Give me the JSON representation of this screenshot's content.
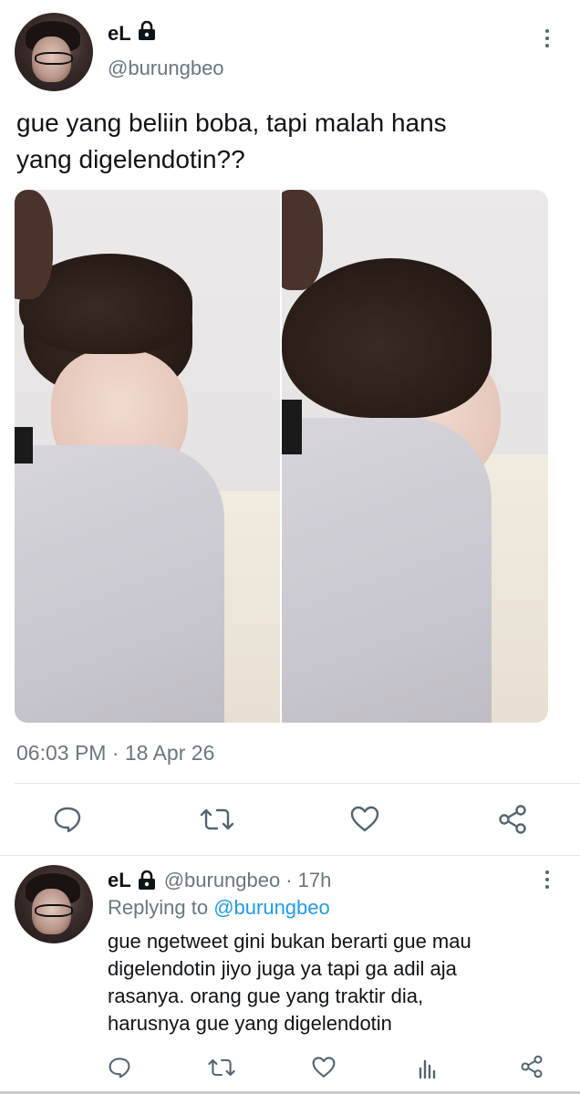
{
  "tweet": {
    "display_name": "eL",
    "handle": "@burungbeo",
    "text_line1": "gue yang beliin boba, tapi malah hans",
    "text_line2": "yang digelendotin??",
    "timestamp": "06:03 PM · 18 Apr 26"
  },
  "reply": {
    "display_name": "eL",
    "handle": "@burungbeo",
    "time": "· 17h",
    "replying_prefix": "Replying to",
    "replying_handle": "@burungbeo",
    "lines": [
      "gue ngetweet gini bukan berarti gue mau",
      "digelendotin jiyo juga ya tapi ga adil aja",
      "rasanya. orang gue yang traktir dia,",
      "harusnya gue yang digelendotin"
    ]
  },
  "icons": {
    "lock": "lock-icon",
    "more": "more-vertical-icon",
    "reply": "reply-icon",
    "retweet": "retweet-icon",
    "like": "like-icon",
    "share": "share-icon",
    "analytics": "analytics-icon"
  },
  "colors": {
    "accent": "#1d9bf0",
    "text": "#0f1419",
    "secondary": "#6b7680",
    "icon": "#536471"
  }
}
